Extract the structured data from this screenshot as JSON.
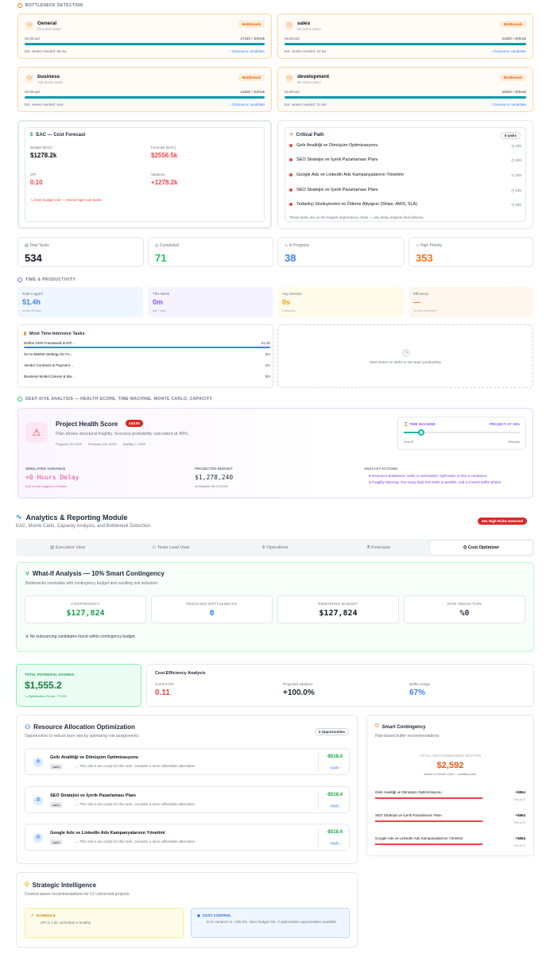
{
  "bottleneck": {
    "section_title": "BOTTLENECK DETECTION",
    "cards": [
      {
        "name": "General",
        "sub": "83 active tasks",
        "badge": "Bottleneck",
        "wl_label": "Workload",
        "wl_value": "2724h / 40h/wk",
        "ew": "Est. weeks needed: 68.1w",
        "oc": "↑ Outsource candidate"
      },
      {
        "name": "sales",
        "sub": "96 active tasks",
        "badge": "Bottleneck",
        "wl_label": "Workload",
        "wl_value": "2184h / 40h/wk",
        "ew": "Est. weeks needed: 54.6w",
        "oc": "↑ Outsource candidate"
      },
      {
        "name": "business",
        "sub": "104 active tasks",
        "badge": "Bottleneck",
        "wl_label": "Workload",
        "wl_value": "2160h / 40h/wk",
        "ew": "Est. weeks needed: 54w",
        "oc": "↑ Outsource candidate"
      },
      {
        "name": "development",
        "sub": "96 active tasks",
        "badge": "Bottleneck",
        "wl_label": "Workload",
        "wl_value": "2064h / 40h/wk",
        "ew": "Est. weeks needed: 51.6w",
        "oc": "↑ Outsource candidate"
      }
    ]
  },
  "eac": {
    "title": "EAC — Cost Forecast",
    "budget_label": "Budget (BAC)",
    "budget": "$1278.2k",
    "forecast_label": "Forecast (EAC)",
    "forecast": "$2556.5k",
    "cpi_label": "CPI",
    "cpi": "0.10",
    "variance_label": "Variance",
    "variance": "+1278.2k",
    "warn": "↘ Over budget risk — review high-cost tasks."
  },
  "critical": {
    "title": "Critical Path",
    "badge": "5 tasks",
    "items": [
      {
        "name": "Gelir Analitiği ve Dönüşüm Optimizasyonu",
        "h": "◷ 24h"
      },
      {
        "name": "SEO Stratejisi ve İçerik Pazarlaması Planı",
        "h": "◷ 24h"
      },
      {
        "name": "Google Ads ve LinkedIn Ads Kampanyalarının Yönetimi",
        "h": "◷ 24h"
      },
      {
        "name": "SEO Stratejisi ve İçerik Pazarlaması Planı",
        "h": "◷ 24h"
      },
      {
        "name": "Tedarikçi Sözleşmeleri ve Ödeme Altyapısı (Stripe, AWS, SLA)",
        "h": "◷ 24h"
      }
    ],
    "foot": "These tasks are on the longest dependency chain — any delay impacts final delivery."
  },
  "stats": [
    {
      "label": "Total Tasks",
      "value": "534",
      "color": "#111827",
      "icon": "▤"
    },
    {
      "label": "Completed",
      "value": "71",
      "color": "#22c55e",
      "icon": "◎"
    },
    {
      "label": "In Progress",
      "value": "38",
      "color": "#3b82f6",
      "icon": "∿"
    },
    {
      "label": "High Priority",
      "value": "353",
      "color": "#f97316",
      "icon": "♨"
    }
  ],
  "time": {
    "section_title": "TIME & PRODUCTIVITY",
    "cards": [
      {
        "label": "Total Logged",
        "value": "51.4h",
        "sub": "across all tasks",
        "color": "#3b82f6",
        "bg": "#eff6ff"
      },
      {
        "label": "This Week",
        "value": "0m",
        "sub": "last 7 days",
        "color": "#8b5cf6",
        "bg": "#f5f3ff"
      },
      {
        "label": "Avg Session",
        "value": "0s",
        "sub": "0 sessions",
        "color": "#f59e0b",
        "bg": "#fffbeb"
      },
      {
        "label": "Efficiency",
        "value": "—",
        "sub": "on-time completion",
        "color": "#f97316",
        "bg": "#fff7ed"
      }
    ],
    "intensive_title": "Most Time-Intensive Tasks",
    "tasks": [
      {
        "name": "Define OKR Framework & KPI ...",
        "value": "51.3h"
      },
      {
        "name": "Go-to-Market Strategy for Fo...",
        "value": "2m"
      },
      {
        "name": "Vendor Contracts & Payment ...",
        "value": "1m"
      },
      {
        "name": "Business Model Canvas & Ma...",
        "value": "0m"
      }
    ],
    "empty": "Start timers on tasks to see team productivity"
  },
  "deep": {
    "section_title": "DEEP-DIVE ANALYSIS — HEALTH SCORE, TIME MACHINE, MONTE CARLO, CAPACITY",
    "health_title": "Project Health Score",
    "health_badge": "44/100",
    "health_desc": "Plan shows structural fragility. Success probability calculated at 40%.",
    "progress": "Progress 15 ±15%",
    "precision": "Precision 100 ±40%",
    "stability": "Stability 7 ±15%",
    "tm_label": "⌛ TIME MACHINE",
    "tm_value": "PROJECT AT 15%",
    "tm_left": "Kickoff",
    "tm_right": "Release",
    "tm_pos": 0.15,
    "sv_label": "SIMULATED VARIANCE",
    "sv_value": "+0 Hours Delay",
    "sv_sub": "Due to risk triggers in 0 tasks",
    "pb_label": "PROJECTED BUDGET",
    "pb_value": "$1,278,240",
    "pb_sub": "vs Baseline $1,278,240",
    "aa_label": "ANALYST ACTIONS",
    "aa_items": [
      "● Resource Bottleneck: sales is overloaded. Split tasks or hire a contractor.",
      "● Fragility Warning: Too many high-risk tasks in parallel. Add a 2-week buffer phase."
    ]
  },
  "analytics": {
    "title": "Analytics & Reporting Module",
    "sub": "EAC, Monte Carlo, Capacity Analysis, and Bottleneck Detection.",
    "risk_badge": "401 High Risks Detected",
    "tabs": [
      {
        "label": "Executive View",
        "icon": "▥"
      },
      {
        "label": "Team Lead View",
        "icon": "⚇"
      },
      {
        "label": "Operations",
        "icon": "✣"
      },
      {
        "label": "Forecasts",
        "icon": "⚗"
      },
      {
        "label": "Cost Optimizer",
        "icon": "⛭"
      }
    ]
  },
  "whatif": {
    "title": "What-If Analysis — 10% Smart Contingency",
    "sub": "Bottlenecks resolvable with contingency budget and resulting risk reduction.",
    "kpis": [
      {
        "label": "CONTINGENCY",
        "value": "$127,824",
        "color": "#16a34a"
      },
      {
        "label": "RESOLVED BOTTLENECKS",
        "value": "0",
        "color": "#3b82f6"
      },
      {
        "label": "REMAINING BUDGET",
        "value": "$127,824",
        "color": "#111827"
      },
      {
        "label": "RISK REDUCTION",
        "value": "%0",
        "color": "#374151"
      }
    ],
    "note": "No outsourcing candidates found within contingency budget."
  },
  "savings": {
    "label": "TOTAL POTENTIAL SAVINGS",
    "value": "$1,555.2",
    "sub": "↘ Optimization Score: 77/100"
  },
  "efficiency": {
    "title": "Cost Efficiency Analysis",
    "cpi_label": "Current CPI",
    "cpi": "0.11",
    "pv_label": "Projected Variance",
    "pv": "+100.0%",
    "bu_label": "Buffer Usage",
    "bu": "67%"
  },
  "resource": {
    "title": "Resource Allocation Optimization",
    "sub": "Opportunities to reduce burn rate by optimizing role assignments.",
    "badge": "3 Opportunities",
    "items": [
      {
        "name": "Gelir Analitiği ve Dönüşüm Optimizasyonu",
        "tag": "sales",
        "msg": "→  This role is too costly for this task. Consider a more affordable alternative.",
        "amt": "-$518.4",
        "apply": "Apply  ›"
      },
      {
        "name": "SEO Stratejisi ve İçerik Pazarlaması Planı",
        "tag": "sales",
        "msg": "→  This role is too costly for this task. Consider a more affordable alternative.",
        "amt": "-$518.4",
        "apply": "Apply  ›"
      },
      {
        "name": "Google Ads ve LinkedIn Ads Kampanyalarının Yönetimi",
        "tag": "sales",
        "msg": "→  This role is too costly for this task. Consider a more affordable alternative.",
        "amt": "-$518.4",
        "apply": "Apply  ›"
      }
    ]
  },
  "smart": {
    "title": "Smart Contingency",
    "sub": "Risk-based buffer recommendations",
    "total_label": "TOTAL RECOMMENDED BUFFER",
    "total": "$2,592",
    "total_sub": "Based on Monte Carlo + volatility score",
    "items": [
      {
        "name": "Gelir Analitiği ve Dönüşüm Optimizasyonu",
        "v": "+$864",
        "r": "Risk 8/10"
      },
      {
        "name": "SEO Stratejisi ve İçerik Pazarlaması Planı",
        "v": "+$864",
        "r": "Risk 8/10"
      },
      {
        "name": "Google Ads ve LinkedIn Ads Kampanyalarının Yönetimi",
        "v": "+$864",
        "r": "Risk 8/10"
      }
    ]
  },
  "strategic": {
    "title": "Strategic Intelligence",
    "sub": "Context-aware recommendations for 13 connected projects.",
    "s_label": "SCHEDULE",
    "s_text": "SPI is 1.00. Schedule is healthy",
    "c_label": "COST CONTROL",
    "c_text": "EAC variance is +100.0%. Over budget risk. 3 optimization opportunities available."
  }
}
